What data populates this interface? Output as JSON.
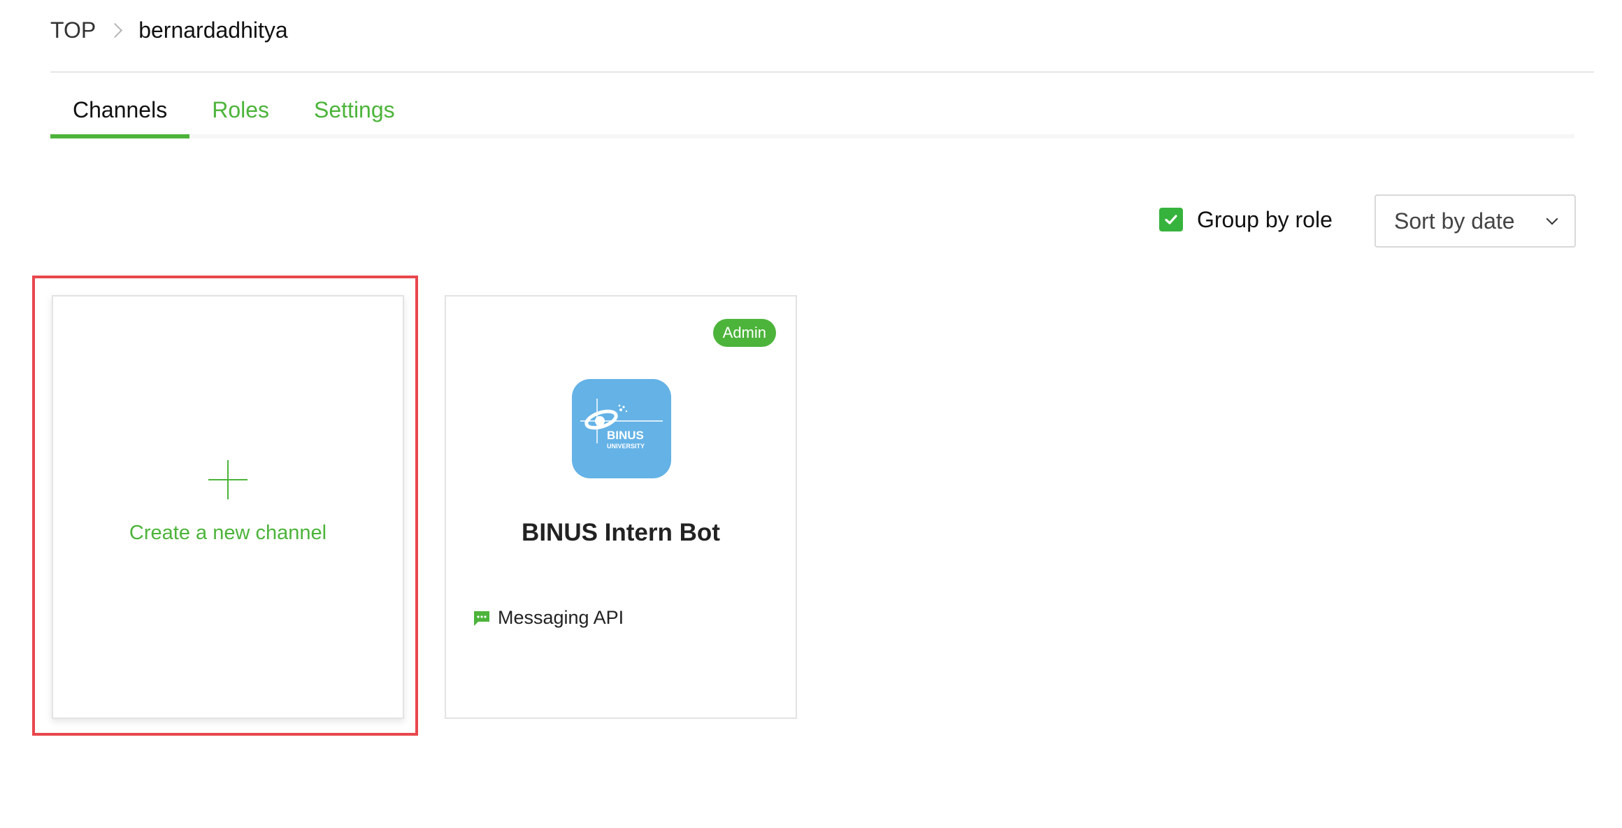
{
  "breadcrumb": {
    "root": "TOP",
    "current": "bernardadhitya"
  },
  "tabs": [
    {
      "label": "Channels",
      "active": true
    },
    {
      "label": "Roles",
      "active": false
    },
    {
      "label": "Settings",
      "active": false
    }
  ],
  "toolbar": {
    "group_by_label": "Group by role",
    "group_by_checked": true,
    "sort_value": "Sort by date"
  },
  "cards": {
    "new_channel_label": "Create a new channel",
    "bot": {
      "role_badge": "Admin",
      "name": "BINUS Intern Bot",
      "type": "Messaging API",
      "logo_text_main": "BINUS",
      "logo_text_sub": "UNIVERSITY"
    }
  },
  "colors": {
    "accent": "#4cb43a",
    "highlight": "#e8474d",
    "logo_bg": "#64b2e6"
  }
}
